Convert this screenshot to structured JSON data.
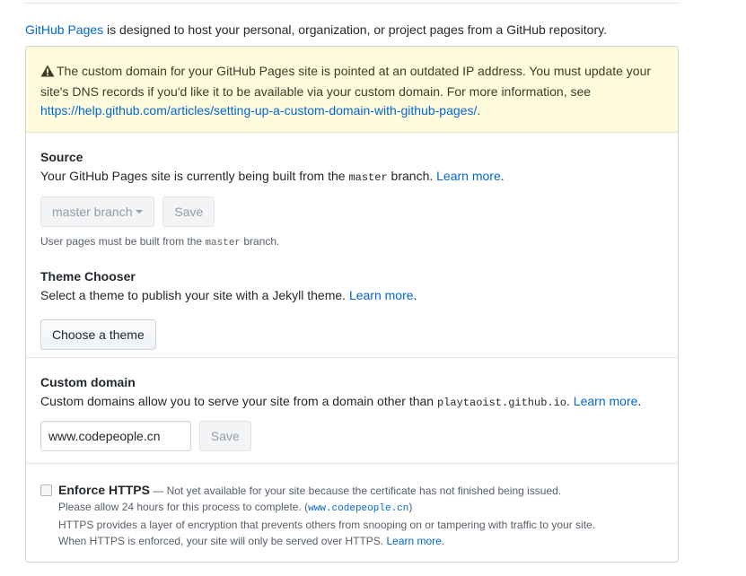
{
  "intro": {
    "link": "GitHub Pages",
    "text": " is designed to host your personal, organization, or project pages from a GitHub repository."
  },
  "flash": {
    "icon": "warning-icon",
    "message": "The custom domain for your GitHub Pages site is pointed at an outdated IP address. You must update your site's DNS records if you'd like it to be available via your custom domain. For more information, see ",
    "link": "https://help.github.com/articles/setting-up-a-custom-domain-with-github-pages/",
    "suffix": "."
  },
  "source": {
    "heading": "Source",
    "text_before": "Your GitHub Pages site is currently being built from the ",
    "branch_code": "master",
    "text_after": " branch. ",
    "learn_more": "Learn more",
    "period": ".",
    "branch_button": "master branch",
    "save_button": "Save",
    "note_before": "User pages must be built from the ",
    "note_code": "master",
    "note_after": " branch."
  },
  "theme": {
    "heading": "Theme Chooser",
    "text": "Select a theme to publish your site with a Jekyll theme. ",
    "learn_more": "Learn more",
    "period": ".",
    "button": "Choose a theme"
  },
  "custom_domain": {
    "heading": "Custom domain",
    "text_before": "Custom domains allow you to serve your site from a domain other than ",
    "domain_code": "playtaoist.github.io",
    "text_after": ". ",
    "learn_more": "Learn more",
    "period": ".",
    "input_value": "www.codepeople.cn",
    "save_button": "Save"
  },
  "https": {
    "label": "Enforce HTTPS",
    "dash_text": " — Not yet available for your site because the certificate has not finished being issued.",
    "line2_before": "Please allow 24 hours for this process to complete. (",
    "line2_code": "www.codepeople.cn",
    "line2_after": ")",
    "line3": "HTTPS provides a layer of encryption that prevents others from snooping on or tampering with traffic to your site.",
    "line4": "When HTTPS is enforced, your site will only be served over HTTPS. ",
    "learn_more": "Learn more",
    "period": "."
  },
  "colors": {
    "link": "#0366d6",
    "flash_bg": "#fffbdd",
    "warning_icon": "#b08800"
  }
}
